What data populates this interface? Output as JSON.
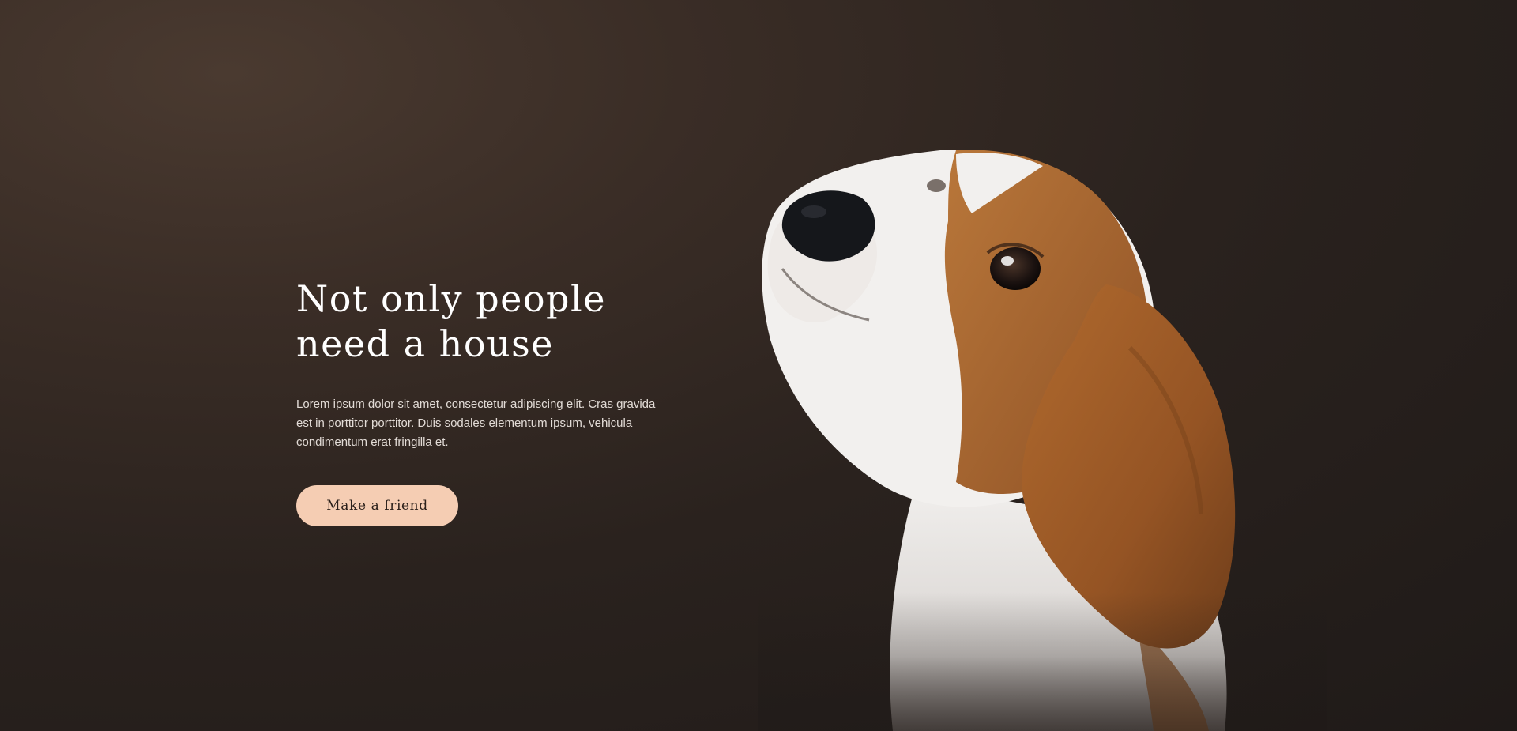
{
  "hero": {
    "headline_line1": "Not only people",
    "headline_line2": "need a house",
    "description": "Lorem ipsum dolor sit amet, consectetur adipiscing elit. Cras gravida est in porttitor  porttitor. Duis sodales elementum ipsum, vehicula condimentum erat fringilla et.",
    "cta_label": "Make a friend"
  },
  "image": {
    "subject": "beagle-puppy-photo"
  },
  "colors": {
    "background": "#2a221e",
    "cta_background": "#f5cdb3",
    "cta_text": "#2a1f1a",
    "headline": "#ffffff",
    "body_text": "#e2dbd6",
    "dog_brown": "#a8652c",
    "dog_white": "#f2f0ee"
  }
}
